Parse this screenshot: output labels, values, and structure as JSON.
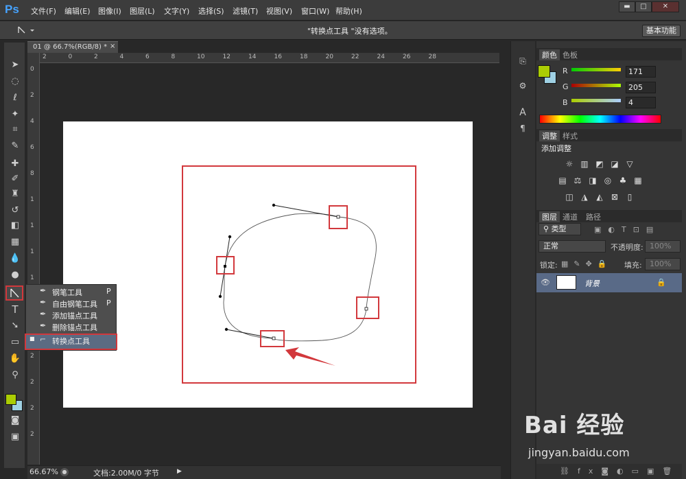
{
  "app": {
    "logo": "Ps"
  },
  "menu": [
    "文件(F)",
    "编辑(E)",
    "图像(I)",
    "图层(L)",
    "文字(Y)",
    "选择(S)",
    "滤镜(T)",
    "视图(V)",
    "窗口(W)",
    "帮助(H)"
  ],
  "options_bar": {
    "hint": "\"转换点工具 \"没有选项。",
    "workspace": "基本功能"
  },
  "document": {
    "tab": "01 @ 66.7%(RGB/8) *",
    "close": "×"
  },
  "ruler_top": [
    "2",
    "0",
    "2",
    "4",
    "6",
    "8",
    "10",
    "12",
    "14",
    "16",
    "18",
    "20",
    "22",
    "24",
    "26",
    "28"
  ],
  "ruler_left": [
    "0",
    "2",
    "4",
    "6",
    "8",
    "1",
    "1",
    "1",
    "1",
    "1",
    "2",
    "2",
    "2",
    "2",
    "2"
  ],
  "flyout": {
    "items": [
      {
        "label": "钢笔工具",
        "key": "P"
      },
      {
        "label": "自由钢笔工具",
        "key": "P"
      },
      {
        "label": "添加锚点工具",
        "key": ""
      },
      {
        "label": "删除锚点工具",
        "key": ""
      },
      {
        "label": "转换点工具",
        "key": ""
      }
    ]
  },
  "status": {
    "zoom": "66.67%",
    "doc": "文档:2.00M/0 字节"
  },
  "color_panel": {
    "tabs": [
      "颜色",
      "色板"
    ],
    "channels": [
      {
        "label": "R",
        "value": "171"
      },
      {
        "label": "G",
        "value": "205"
      },
      {
        "label": "B",
        "value": "4"
      }
    ],
    "foreground": "#abcd04",
    "background": "#9fd1e4"
  },
  "adjust_panel": {
    "tabs": [
      "调整",
      "样式"
    ],
    "title": "添加调整"
  },
  "layers_panel": {
    "tabs": [
      "图层",
      "通道",
      "路径"
    ],
    "filter": "类型",
    "blend": "正常",
    "opacity_label": "不透明度:",
    "opacity": "100%",
    "lock_label": "锁定:",
    "fill_label": "填充:",
    "fill": "100%",
    "layer_name": "背景"
  },
  "watermark": {
    "logo": "Bai 经验",
    "url": "jingyan.baidu.com"
  }
}
